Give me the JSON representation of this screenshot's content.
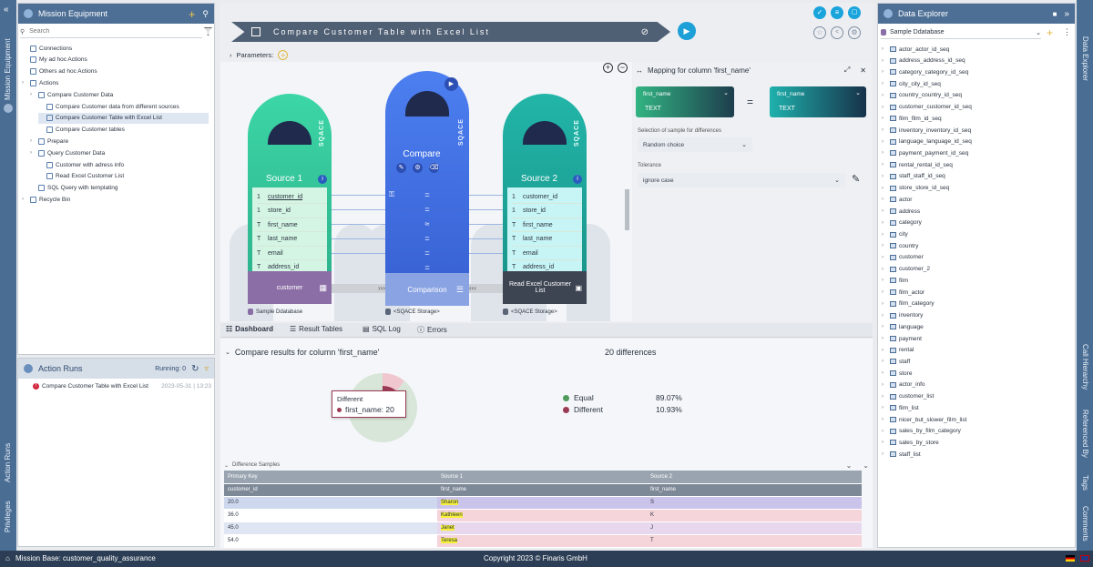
{
  "left_panel": {
    "title": "Mission Equipment",
    "search_placeholder": "Search",
    "tree": [
      {
        "label": "Connections",
        "indent": 1
      },
      {
        "label": "My ad hoc Actions",
        "indent": 1
      },
      {
        "label": "Others ad hoc Actions",
        "indent": 1
      },
      {
        "label": "Actions",
        "indent": 1
      },
      {
        "label": "Compare Customer Data",
        "indent": 2
      },
      {
        "label": "Compare Customer data from different sources",
        "indent": 3
      },
      {
        "label": "Compare Customer Table with Excel List",
        "indent": 3
      },
      {
        "label": "Compare Customer tables",
        "indent": 3
      },
      {
        "label": "Prepare",
        "indent": 2
      },
      {
        "label": "Query Customer Data",
        "indent": 2
      },
      {
        "label": "Customer with adress info",
        "indent": 3
      },
      {
        "label": "Read Excel Customer List",
        "indent": 3
      },
      {
        "label": "SQL Query with templating",
        "indent": 2
      },
      {
        "label": "Recycle Bin",
        "indent": 1
      }
    ]
  },
  "action_runs": {
    "title": "Action Runs",
    "running": "Running: 0",
    "item": "Compare Customer Table with Excel List",
    "item_time": "2023-05-31 | 13:23"
  },
  "rail_left": {
    "mission": "Mission Equipment",
    "runs": "Action Runs",
    "privileges": "Privileges"
  },
  "rail_right": {
    "data_explorer": "Data Explorer",
    "call_hierarchy": "Call Hierarchy",
    "referenced_by": "Referenced By",
    "tags": "Tags",
    "comments": "Comments"
  },
  "center": {
    "banner_title": "Compare Customer Table with Excel List",
    "parameters_label": "Parameters:",
    "source1": {
      "title": "Source 1",
      "brand": "SQACE",
      "fields": [
        "customer_id",
        "store_id",
        "first_name",
        "last_name",
        "email",
        "address_id"
      ],
      "footer": "customer",
      "caption": "Sample Ddatabase"
    },
    "compare": {
      "title": "Compare",
      "brand": "SQACE",
      "symbols": [
        "=",
        "=",
        "≈",
        "=",
        "=",
        "="
      ],
      "footer": "Comparison",
      "caption": "<SQACE Storage>"
    },
    "source2": {
      "title": "Source 2",
      "brand": "SQACE",
      "fields": [
        "customer_id",
        "store_id",
        "first_name",
        "last_name",
        "email",
        "address_id"
      ],
      "footer": "Read Excel Customer List",
      "caption": "<SQACE Storage>"
    }
  },
  "mapping": {
    "title": "Mapping for column 'first_name'",
    "left_col": "first_name",
    "left_type": "TEXT",
    "right_col": "first_name",
    "right_type": "TEXT",
    "equals": "=",
    "sample_label": "Selection of sample for differences",
    "sample_value": "Random choice",
    "tolerance_label": "Tolerance",
    "tolerance_value": "ignore case"
  },
  "tabs": [
    "Dashboard",
    "Result Tables",
    "SQL Log",
    "Errors"
  ],
  "results": {
    "title": "Compare results for column 'first_name'",
    "differences": "20 differences",
    "tooltip_title": "Different",
    "tooltip_value": "first_name: 20",
    "legend": [
      {
        "label": "Equal",
        "pct": "89.07%",
        "color": "#4f9a5c"
      },
      {
        "label": "Different",
        "pct": "10.93%",
        "color": "#9b3a55"
      }
    ],
    "pie": {
      "equal": 89.07,
      "different": 10.93
    }
  },
  "samples": {
    "title": "Difference Samples",
    "group_headers": [
      "Primary Key",
      "Source 1",
      "Source 2"
    ],
    "col_headers": [
      "customer_id",
      "first_name",
      "first_name"
    ],
    "rows": [
      [
        "20.0",
        "Sharon",
        "S"
      ],
      [
        "36.0",
        "Kathleen",
        "K"
      ],
      [
        "45.0",
        "Janet",
        "J"
      ],
      [
        "54.0",
        "Teresa",
        "T"
      ]
    ]
  },
  "data_explorer": {
    "title": "Data Explorer",
    "db": "Sample Ddatabase",
    "items": [
      "actor_actor_id_seq",
      "address_address_id_seq",
      "category_category_id_seq",
      "city_city_id_seq",
      "country_country_id_seq",
      "customer_customer_id_seq",
      "film_film_id_seq",
      "inventory_inventory_id_seq",
      "language_language_id_seq",
      "payment_payment_id_seq",
      "rental_rental_id_seq",
      "staff_staff_id_seq",
      "store_store_id_seq",
      "actor",
      "address",
      "category",
      "city",
      "country",
      "customer",
      "customer_2",
      "film",
      "film_actor",
      "film_category",
      "inventory",
      "language",
      "payment",
      "rental",
      "staff",
      "store",
      "actor_info",
      "customer_list",
      "film_list",
      "nicer_but_slower_film_list",
      "sales_by_film_category",
      "sales_by_store",
      "staff_list"
    ]
  },
  "status": {
    "mission_base": "Mission Base: customer_quality_assurance",
    "copyright": "Copyright 2023 © Finaris GmbH"
  }
}
